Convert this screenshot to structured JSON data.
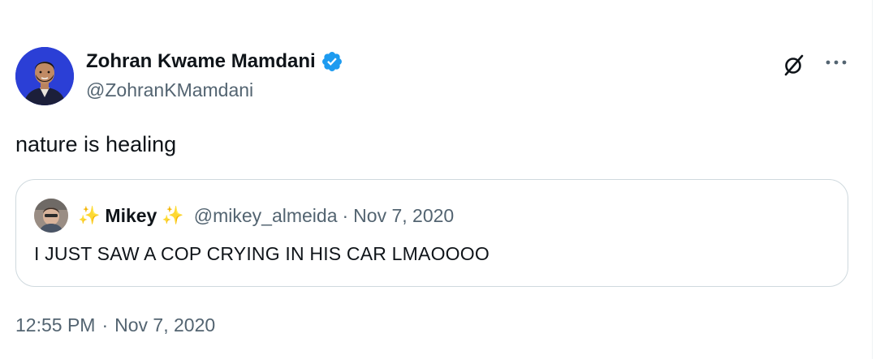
{
  "tweet": {
    "author": {
      "display_name": "Zohran Kwame Mamdani",
      "handle": "@ZohranKMamdani",
      "verified": true,
      "avatar_icon": "profile-photo"
    },
    "text": "nature is healing",
    "actions": {
      "grok_icon": "grok-icon",
      "more_icon": "more-icon"
    },
    "quoted": {
      "sparkle": "✨",
      "display_name": "Mikey",
      "handle": "@mikey_almeida",
      "separator": "·",
      "date": "Nov 7, 2020",
      "text": "I JUST SAW A COP CRYING IN HIS CAR LMAOOOO"
    },
    "timestamp": {
      "time": "12:55 PM",
      "separator": "·",
      "date": "Nov 7, 2020"
    }
  },
  "colors": {
    "text_primary": "#0f1419",
    "text_secondary": "#536471",
    "verified_blue": "#1d9bf0",
    "border": "#cfd9de",
    "avatar_bg": "#2b3fd6"
  }
}
